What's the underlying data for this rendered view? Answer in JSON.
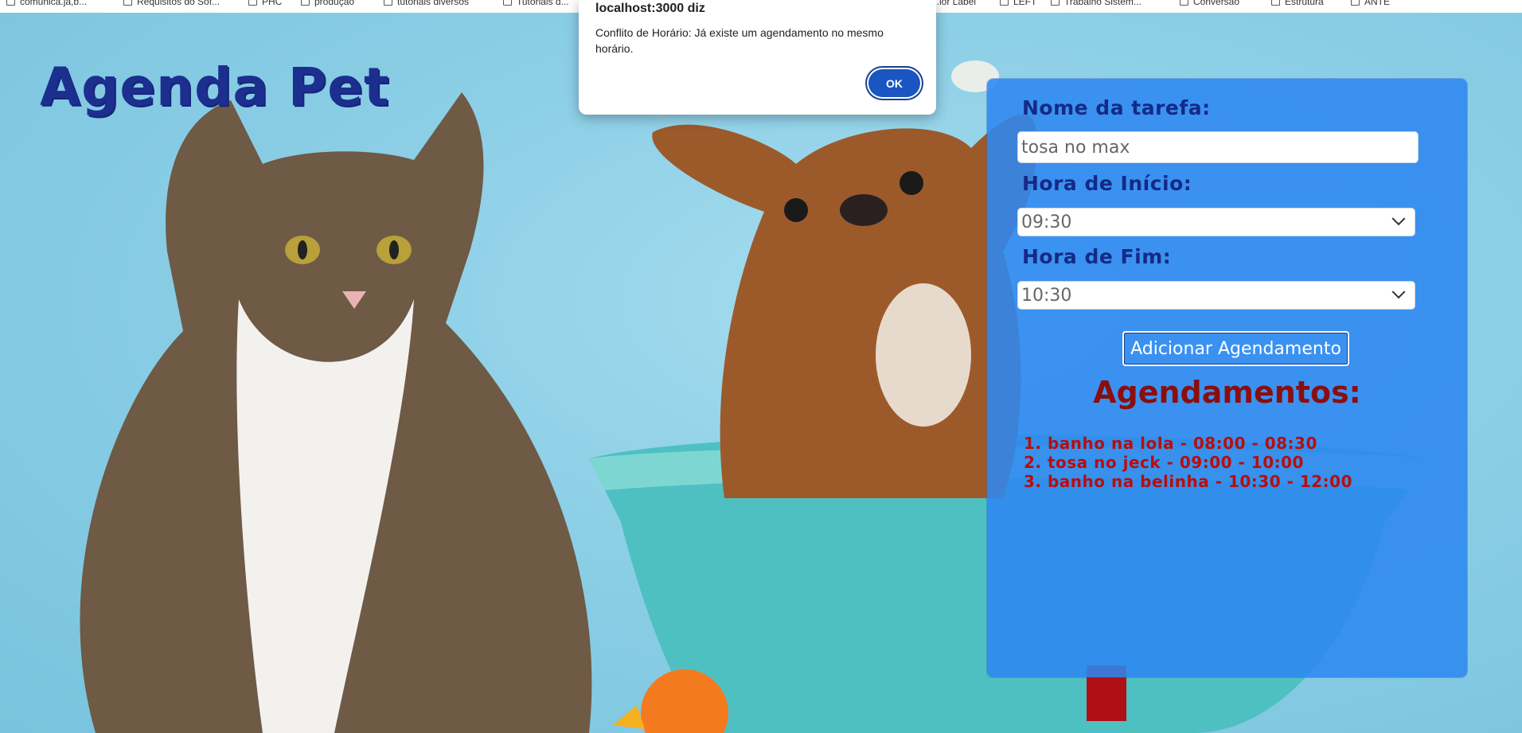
{
  "bookmarks": [
    "comunica.ja,b...",
    "Requisitos do Sof...",
    "PHC",
    "produção",
    "tutoriais diversos",
    "Tutoriais d...",
    "...ior Label",
    "LEFT",
    "Trabalho Sistem...",
    "Conversão",
    "Estrutura",
    "ANTE"
  ],
  "page": {
    "title": "Agenda Pet"
  },
  "form": {
    "task_label": "Nome da tarefa:",
    "task_value": "tosa no max",
    "start_label": "Hora de Início:",
    "start_value": "09:30",
    "end_label": "Hora de Fim:",
    "end_value": "10:30",
    "add_button": "Adicionar Agendamento"
  },
  "appointments": {
    "title": "Agendamentos:",
    "items": [
      "1. banho na lola - 08:00 - 08:30",
      "2. tosa no jeck - 09:00 - 10:00",
      "3. banho na belinha - 10:30 - 12:00"
    ]
  },
  "dialog": {
    "title": "localhost:3000 diz",
    "message": "Conflito de Horário: Já existe um agendamento no mesmo horário.",
    "ok": "OK"
  }
}
